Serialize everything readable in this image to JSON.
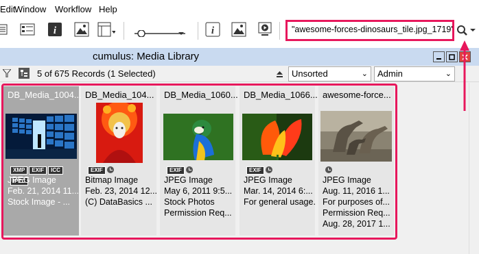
{
  "menu": {
    "items": [
      "Edit",
      "Window",
      "Workflow",
      "Help"
    ]
  },
  "toolbar": {
    "search_value": "\"awesome-forces-dinosaurs_tile.jpg_1719\" ||",
    "icons": [
      "list-view-icon",
      "detail-view-icon",
      "info-icon",
      "image-icon",
      "layout-icon",
      "slider-icon",
      "info-icon",
      "image-icon",
      "play-icon",
      "search-icon"
    ]
  },
  "window": {
    "title": "cumulus: Media Library",
    "records": "5 of 675 Records (1 Selected)",
    "sort": "Unsorted",
    "view": "Admin"
  },
  "cards": [
    {
      "name": "DB_Media_1004...",
      "badges": [
        "XMP",
        "EXIF",
        "ICC",
        "IPTC"
      ],
      "lines": [
        "JPEG Image",
        "Feb. 21, 2014 11...",
        "Stock Image - ..."
      ],
      "selected": true
    },
    {
      "name": "DB_Media_104...",
      "badges": [
        "EXIF"
      ],
      "lines": [
        "Bitmap Image",
        "Feb. 23, 2014 12...",
        "(C) DataBasics ..."
      ],
      "selected": false
    },
    {
      "name": "DB_Media_1060...",
      "badges": [
        "EXIF"
      ],
      "lines": [
        "JPEG Image",
        "May 6, 2011 9:5...",
        "Stock Photos",
        "Permission Req..."
      ],
      "selected": false
    },
    {
      "name": "DB_Media_1066...",
      "badges": [
        "EXIF"
      ],
      "lines": [
        "JPEG Image",
        "Mar. 14, 2014 6:...",
        "For general usage."
      ],
      "selected": false
    },
    {
      "name": "awesome-force...",
      "badges": [],
      "lines": [
        "JPEG Image",
        "Aug. 11, 2016 1...",
        "For purposes of...",
        "Permission Req...",
        "Aug. 28, 2017 1..."
      ],
      "selected": false
    }
  ],
  "colors": {
    "highlight": "#e7175c",
    "title_bar": "#c9daf0",
    "selected_card": "#a9a9a9"
  }
}
